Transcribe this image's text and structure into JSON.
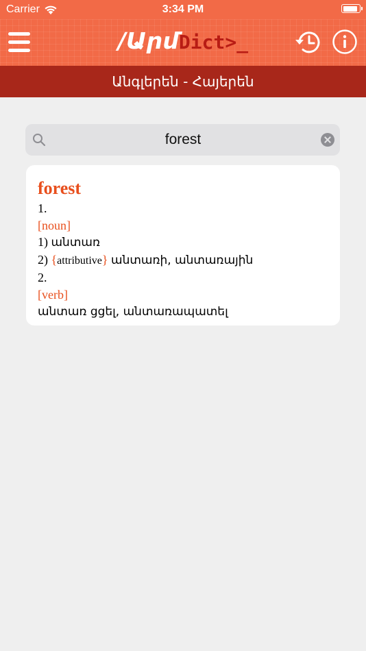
{
  "status_bar": {
    "carrier": "Carrier",
    "time": "3:34 PM"
  },
  "nav": {
    "logo_prefix": "/Արմ",
    "logo_mid": "Dict>",
    "logo_cursor": "_"
  },
  "language_bar": {
    "label": "Անգլերեն - Հայերեն"
  },
  "search": {
    "value": "forest"
  },
  "entry": {
    "headword": "forest",
    "senses": [
      {
        "number": "1.",
        "pos": "[noun]",
        "definitions": [
          {
            "index": "1)",
            "text": "անտառ"
          },
          {
            "index": "2)",
            "brace_open": "{",
            "label": "attributive",
            "brace_close": "}",
            "text": "անտառի, անտառային"
          }
        ]
      },
      {
        "number": "2.",
        "pos": "[verb]",
        "definitions": [
          {
            "text": "անտառ ցցել, անտառապատել"
          }
        ]
      }
    ]
  },
  "colors": {
    "nav_background": "#f26a47",
    "language_bar_background": "#a8271a",
    "accent": "#e84f1d",
    "page_background": "#efefef"
  },
  "icons": {
    "menu": "hamburger-icon",
    "history": "history-icon",
    "info": "info-icon",
    "search": "search-icon",
    "clear": "clear-icon"
  }
}
